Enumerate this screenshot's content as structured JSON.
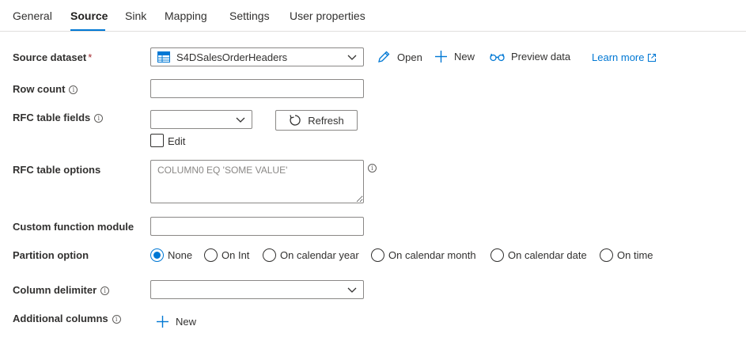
{
  "tabs": [
    {
      "label": "General"
    },
    {
      "label": "Source",
      "active": true
    },
    {
      "label": "Sink"
    },
    {
      "label": "Mapping"
    },
    {
      "label": "Settings"
    },
    {
      "label": "User properties"
    }
  ],
  "source_dataset": {
    "label": "Source dataset",
    "required_marker": "*",
    "value": "S4DSalesOrderHeaders",
    "icon": "sap-table-icon",
    "open_label": "Open",
    "new_label": "New",
    "preview_label": "Preview data",
    "learn_more_label": "Learn more"
  },
  "row_count": {
    "label": "Row count",
    "value": ""
  },
  "rfc_table_fields": {
    "label": "RFC table fields",
    "value": "",
    "refresh_label": "Refresh",
    "edit_label": "Edit",
    "edit_checked": false
  },
  "rfc_table_options": {
    "label": "RFC table options",
    "placeholder": "COLUMN0 EQ 'SOME VALUE'"
  },
  "custom_function_module": {
    "label": "Custom function module",
    "value": ""
  },
  "partition_option": {
    "label": "Partition option",
    "options": [
      "None",
      "On Int",
      "On calendar year",
      "On calendar month",
      "On calendar date",
      "On time"
    ],
    "selected": "None"
  },
  "column_delimiter": {
    "label": "Column delimiter",
    "value": ""
  },
  "additional_columns": {
    "label": "Additional columns",
    "new_label": "New"
  },
  "colors": {
    "accent": "#0078d4",
    "text": "#323130",
    "border": "#8a8886"
  }
}
